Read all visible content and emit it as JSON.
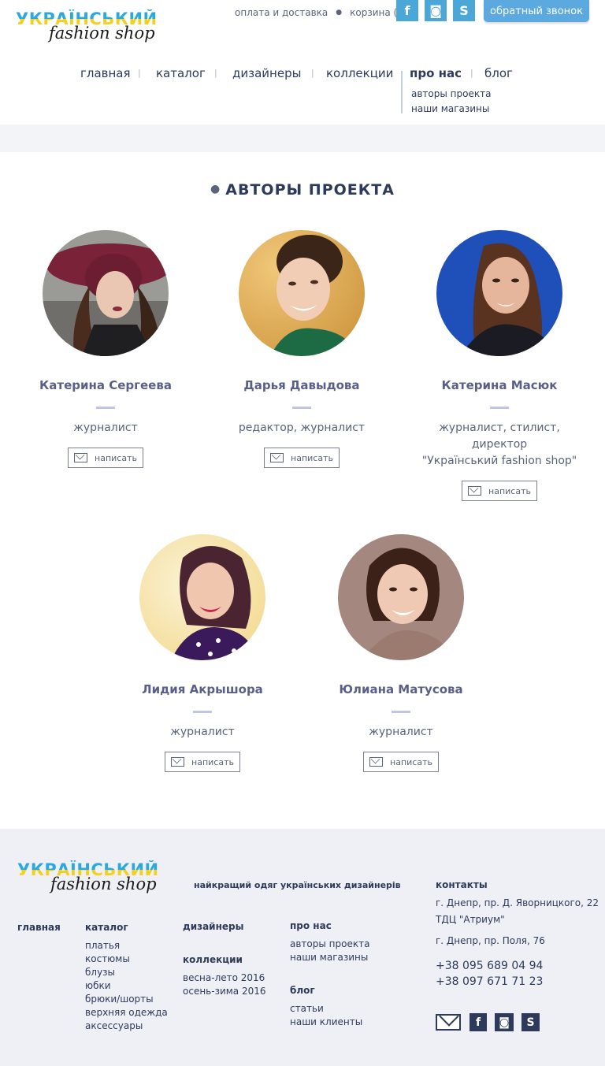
{
  "logo": {
    "top": "УКРАЇНСЬКИЙ",
    "bottom": "fashion shop"
  },
  "top_links": {
    "delivery": "оплата и доставка",
    "cart": "корзина (0)"
  },
  "social": {
    "facebook": "f",
    "instagram": "◙",
    "skype": "S"
  },
  "callback_label": "обратный звонок",
  "nav": {
    "home": "главная",
    "catalog": "каталог",
    "designers": "дизайнеры",
    "collections": "коллекции",
    "about": "про нас",
    "blog": "блог",
    "submenu": [
      "авторы проекта",
      "наши магазины"
    ]
  },
  "section_title": "АВТОРЫ ПРОЕКТА",
  "write_label": "написать",
  "authors": [
    {
      "name": "Катерина Сергеева",
      "role": "журналист"
    },
    {
      "name": "Дарья Давыдова",
      "role": "редактор, журналист"
    },
    {
      "name": "Катерина Масюк",
      "role": "журналист, стилист,\nдиректор\n\"Український fashion shop\""
    },
    {
      "name": "Лидия Акрышора",
      "role": "журналист"
    },
    {
      "name": "Юлиана Матусова",
      "role": "журналист"
    }
  ],
  "footer": {
    "tagline": "найкращий одяг українських дизайнерів",
    "home": "главная",
    "catalog": "каталог",
    "catalog_items": [
      "платья",
      "костюмы",
      "блузы",
      "юбки",
      "брюки/шорты",
      "верхняя одежда",
      "аксессуары"
    ],
    "designers": "дизайнеры",
    "collections": "коллекции",
    "collection_items": [
      "весна-лето 2016",
      "осень-зима 2016"
    ],
    "about": "про нас",
    "about_items": [
      "авторы проекта",
      "наши магазины"
    ],
    "blog": "блог",
    "blog_items": [
      "статьи",
      "наши клиенты"
    ],
    "contacts_title": "контакты",
    "address1": "г. Днепр, пр. Д. Яворницкого, 22",
    "address1b": "ТДЦ \"Атриум\"",
    "address2": "г. Днепр, пр. Поля, 76",
    "phone1": "+38 095 689 04 94",
    "phone2": "+38 097 671 71 23"
  },
  "colors": {
    "accent": "#5ba9de",
    "text": "#2d3a5a",
    "name": "#5a5f87",
    "footer_bg": "#eff0f6"
  }
}
